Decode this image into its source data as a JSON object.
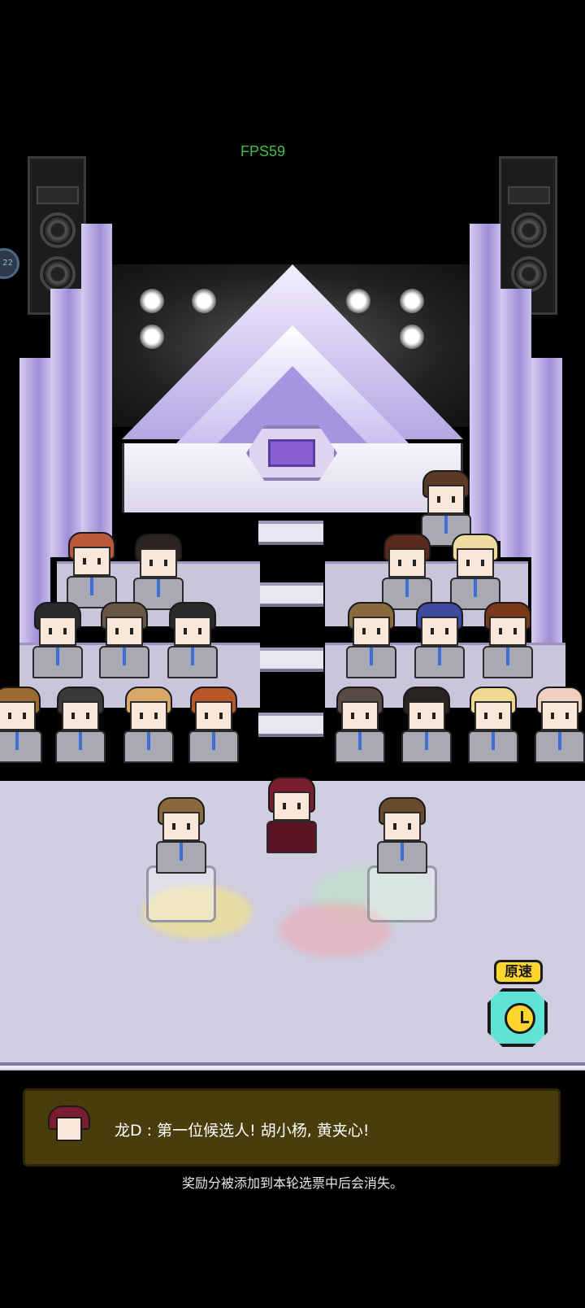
{
  "hud": {
    "fps": "FPS59",
    "side_badge": "22"
  },
  "speed_control": {
    "label": "原速",
    "icon": "clock-icon"
  },
  "dialog": {
    "speaker_avatar": "producer-avatar",
    "text": "龙D : 第一位候选人!  胡小杨, 黄夹心!"
  },
  "notice": "奖励分被添加到本轮选票中后会消失。",
  "colors": {
    "stage_lavender": "#b5a6e2",
    "floor": "#cfcde0",
    "dialog_bg": "#4a3d0c",
    "speed_yellow": "#ffd62e",
    "speed_teal": "#5ee3d6",
    "fps_green": "#3fbf4a"
  },
  "trainees": [
    {
      "hair": "#5a3a24"
    },
    {
      "hair": "#b85a3a"
    },
    {
      "hair": "#2c2420"
    },
    {
      "hair": "#5c2a1c"
    },
    {
      "hair": "#f0dca0"
    },
    {
      "hair": "#2a2a2a"
    },
    {
      "hair": "#6a5644"
    },
    {
      "hair": "#2a2a2a"
    },
    {
      "hair": "#8a6a3c"
    },
    {
      "hair": "#3d4aa0"
    },
    {
      "hair": "#7a3a1a"
    },
    {
      "hair": "#9a6a30"
    },
    {
      "hair": "#3a3a3a"
    },
    {
      "hair": "#d8a86a"
    },
    {
      "hair": "#b8582a"
    },
    {
      "hair": "#5a4a44"
    },
    {
      "hair": "#2a2420"
    },
    {
      "hair": "#f0d890"
    },
    {
      "hair": "#f0cfc0"
    }
  ],
  "candidates": [
    {
      "hair": "#8a6a3c"
    },
    {
      "hair": "#6a4a2c"
    }
  ],
  "host": {
    "hair": "#7a1d2e"
  }
}
